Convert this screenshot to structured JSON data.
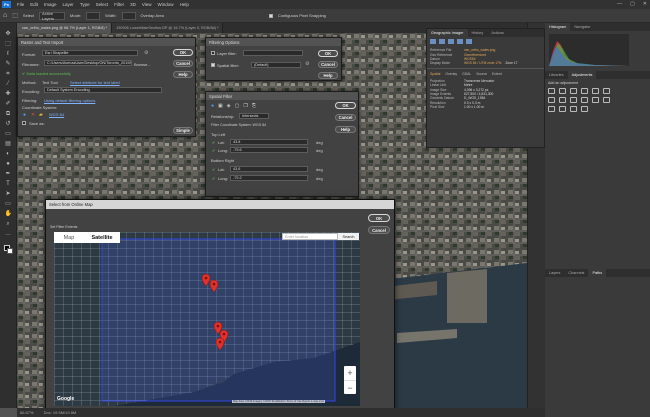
{
  "app": {
    "logo": "Ps",
    "menus": [
      "File",
      "Edit",
      "Image",
      "Layer",
      "Type",
      "Select",
      "Filter",
      "3D",
      "View",
      "Window",
      "Help"
    ],
    "window_controls": [
      "—",
      "▢",
      "✕"
    ]
  },
  "options_bar": {
    "select_label": "Select",
    "subject_dropdown": "Active Layers",
    "mode_label": "Mode:",
    "width_label": "Width:",
    "extra_label": "Overlap Area",
    "pixel_snapping": "Contiguous Pixel Snapping"
  },
  "doc_tabs": [
    {
      "label": "van_ortho_wales.png @ 66.7% (Layer 1, RGB/8) *",
      "active": true
    },
    {
      "label": "190926 LowerMainSection.DP @ 16.7% (Layer 0, RGB/8#) *",
      "active": false
    }
  ],
  "status": {
    "zoom": "66.67%",
    "doc_info": "Doc: 19.5M/19.5M"
  },
  "geo_panel": {
    "tabs": [
      "Geographic Imager",
      "History",
      "Actions"
    ],
    "file_name": "van_ortho_wales.png",
    "rows": [
      {
        "k": "Reference File",
        "v": "van_ortho_wales.png"
      },
      {
        "k": "Geo Reference",
        "v": "Georeferenced"
      },
      {
        "k": "Datum",
        "v": "WGS84"
      },
      {
        "k": "Display Mode",
        "v": "WGS 84 / UTM zone 17N",
        "v2": "Zone 17"
      }
    ],
    "subtabs": [
      "Spatial",
      "Overlay",
      "GDAL",
      "Source",
      "Extent"
    ],
    "details": [
      {
        "k": "Projection",
        "v": "Transverse Mercator"
      },
      {
        "k": "Linear Unit",
        "v": "Metre"
      },
      {
        "k": "Image Size",
        "v": "4,096 x 3,272 px"
      },
      {
        "k": "Image Extents",
        "v": "627,500 / 4,831,300"
      },
      {
        "k": "Geodetic Datum",
        "v": "D_WGS_1984"
      },
      {
        "k": "Resolution",
        "v": "0.3 x 0.3 m"
      },
      {
        "k": "Pixel Size",
        "v": "1.00 x 1.00 m"
      }
    ]
  },
  "histogram_panel": {
    "tabs": [
      "Histogram",
      "Navigator"
    ],
    "colors": [
      "#e23b3b",
      "#3bd24a",
      "#3b6ee2",
      "#d6d6d6"
    ]
  },
  "adjust_panel": {
    "tabs": [
      "Libraries",
      "Adjustments"
    ],
    "hint": "Add an adjustment"
  },
  "layers_panel": {
    "tabs": [
      "Layers",
      "Channels",
      "Paths"
    ]
  },
  "import_dialog": {
    "title": "Raster and Text Import",
    "format_label": "Format:",
    "format_value": "Esri Shapefile",
    "filename_label": "Filename:",
    "filename_value": "C:/Users/AvenzaUser/Desktop/ON/Toronto_2019/Data/toronto.shp",
    "browse_label": "Browse...",
    "loaded_status": "Data loaded successfully",
    "method_label": "Method:",
    "method_value": "Text Tool",
    "select_attr_link": "Select attribute for text label",
    "encoding_label": "Encoding:",
    "encoding_value": "Default System Encoding",
    "filtering_label": "Filtering:",
    "filtering_link": "Using default filtering options",
    "coord_label": "Coordinate System:",
    "coord_link": "WGS 84",
    "save_label": "Save as:",
    "buttons": [
      "OK",
      "Cancel",
      "Help",
      "Simple"
    ]
  },
  "filtering_dialog": {
    "title": "Filtering Options",
    "layer_filter_label": "Layer filter:",
    "spatial_filter_label": "Spatial filter:",
    "spatial_value": "(Default)",
    "buttons": [
      "OK",
      "Cancel",
      "Help"
    ]
  },
  "spatial_dialog": {
    "title": "Spatial Filter",
    "relationship_label": "Relationship:",
    "relationship_value": "Intersects",
    "coord_sys_text": "Filter Coordinate System:  WGS 84",
    "top_left_label": "Top Left",
    "bottom_right_label": "Bottom Right",
    "lat_label": "Lat:",
    "long_label": "Long:",
    "deg": "deg",
    "tl_lat": "43.8",
    "tl_long": "-79.6",
    "br_lat": "43.6",
    "br_long": "-79.2",
    "buttons": [
      "OK",
      "Cancel",
      "Help"
    ]
  },
  "online_dialog": {
    "title": "Select from Online Map",
    "set_filter_label": "Set Filter Extents",
    "map_tab": "Map",
    "satellite_tab": "Satellite",
    "search_placeholder": "Enter location",
    "search_button": "Search",
    "zoom_in": "+",
    "zoom_out": "−",
    "google": "Google",
    "attribution": "Map data ©2019 Imagery ©2019 TerraMetrics  Terms of Use  Report a map error",
    "buttons": [
      "OK",
      "Cancel"
    ],
    "pin_count": 5
  }
}
